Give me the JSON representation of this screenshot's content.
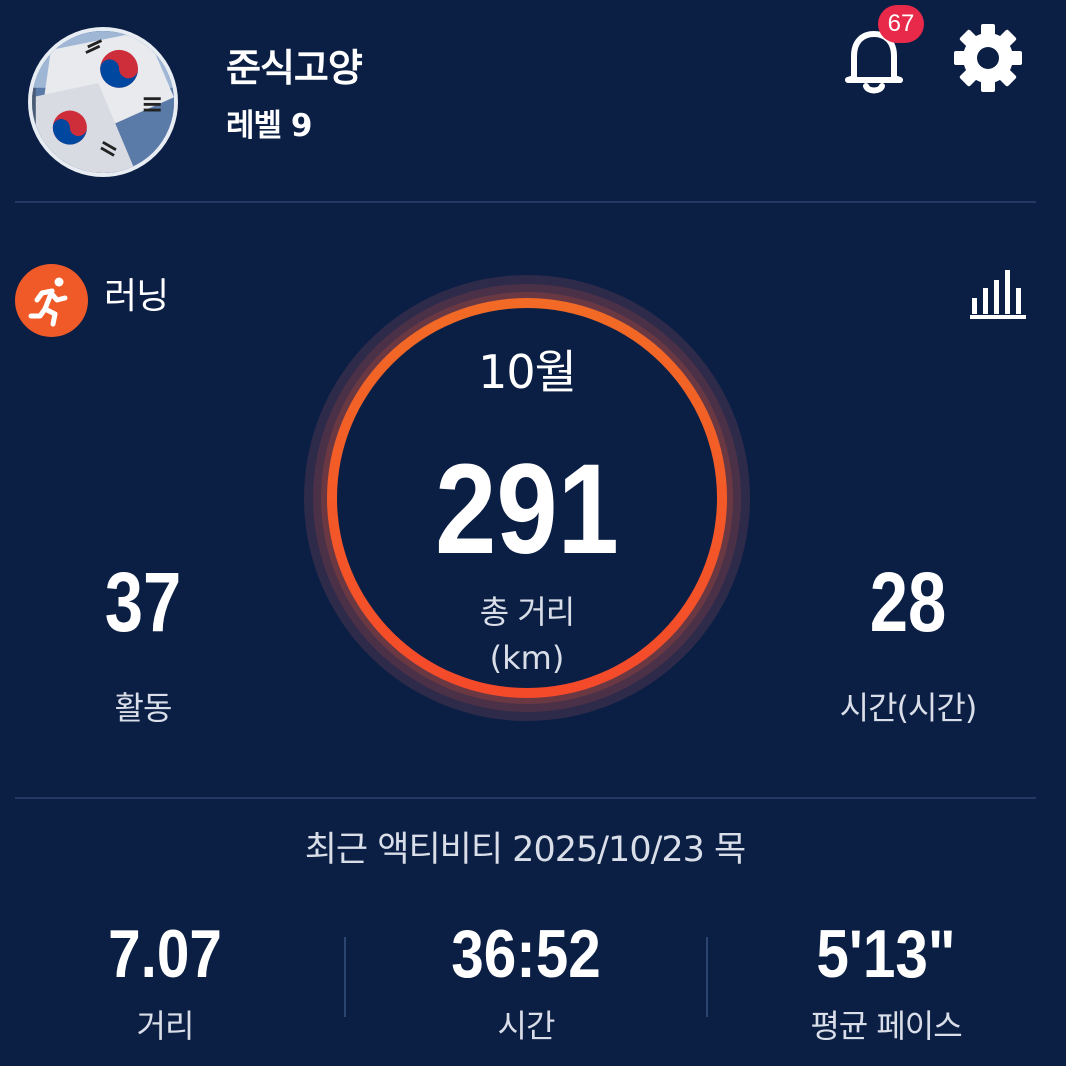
{
  "profile": {
    "username": "준식고양",
    "level": "레벨 9",
    "avatar_icon": "korean-flag-avatar"
  },
  "header": {
    "notification_count": "67",
    "bell_icon": "bell-icon",
    "settings_icon": "gear-icon"
  },
  "activity": {
    "type_label": "러닝",
    "type_icon": "running-person-icon",
    "stats_icon": "bar-chart-icon"
  },
  "summary": {
    "month": "10월",
    "total_distance": "291",
    "total_distance_label": "총 거리",
    "total_distance_unit": "(km)",
    "activities_value": "37",
    "activities_label": "활동",
    "hours_value": "28",
    "hours_label": "시간(시간)"
  },
  "recent": {
    "title": "최근 액티비티 2025/10/23 목",
    "distance_value": "7.07",
    "distance_label": "거리",
    "time_value": "36:52",
    "time_label": "시간",
    "pace_value": "5'13\"",
    "pace_label": "평균 페이스"
  },
  "colors": {
    "background": "#0b1f45",
    "accent": "#f05a28",
    "badge": "#e8294a"
  }
}
